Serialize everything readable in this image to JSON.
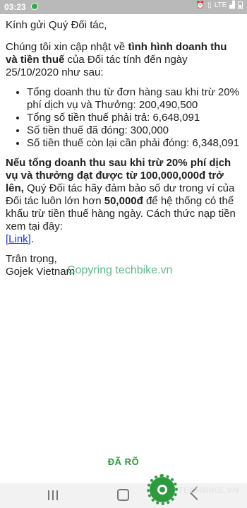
{
  "status_bar": {
    "time": "03:23",
    "icons": [
      "alarm-icon",
      "vibrate-icon",
      "lte-icon",
      "signal-icon",
      "battery-icon"
    ],
    "lte_label": "LTE"
  },
  "message": {
    "greeting": "Kính gửi Quý Đối tác,",
    "intro_prefix": "Chúng tôi xin cập nhật về ",
    "intro_bold": "tình hình doanh thu và tiền thuế",
    "intro_suffix": " của Đối tác tính đến ngày 25/10/2020 như sau:",
    "bullets": [
      "Tổng doanh thu từ đơn hàng sau khi trừ 20% phí dịch vụ và Thưởng: 200,490,500",
      "Tổng số tiền thuế phải trả: 6,648,091",
      "Số tiền thuế đã đóng: 300,000",
      "Số tiền thuế còn lại cần phải đóng: 6,348,091"
    ],
    "notice_bold": "Nếu tổng doanh thu sau khi trừ 20% phí dịch vụ và thưởng đạt được từ 100,000,000đ trở lên,",
    "notice_mid": " Quý Đối tác hãy đảm bảo số dư trong ví của Đối tác luôn lớn hơn ",
    "notice_amount": "50,000đ",
    "notice_end": " để hệ thống có thể khấu trừ tiền thuế hàng ngày. Cách thức nạp tiền xem tại đây:",
    "link_label": "[Link]",
    "link_after": ".",
    "closing": "Trân trọng,",
    "signature": "Gojek Vietnam"
  },
  "watermark": "Copyring techbike.vn",
  "ack_button": "ĐÃ RÕ",
  "logo_text": "TECHBIKE.VN",
  "colors": {
    "accent": "#2e9a3f",
    "link": "#1a3bbf",
    "status_bar": "#b9b9b9"
  }
}
